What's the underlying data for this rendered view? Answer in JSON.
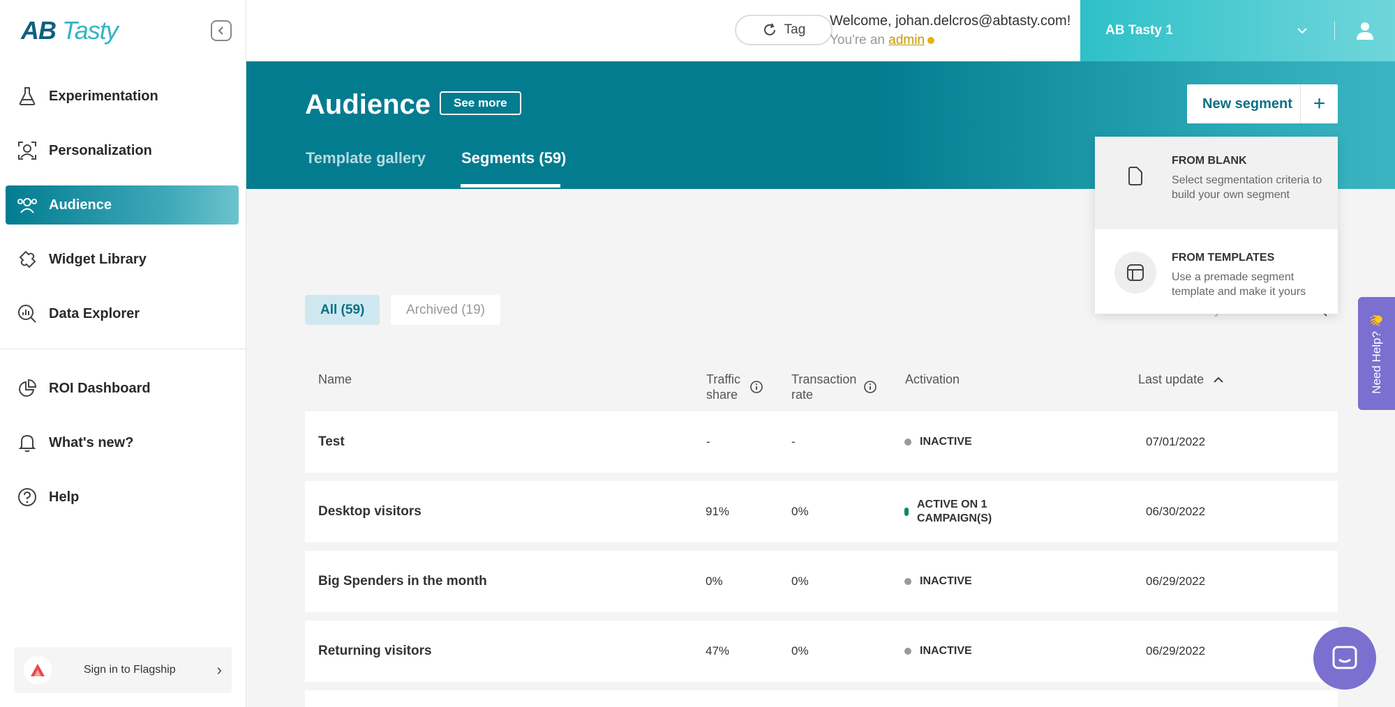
{
  "brand": {
    "logo_ab": "AB",
    "logo_tasty": "Tasty"
  },
  "sidebar": {
    "items": [
      {
        "label": "Experimentation",
        "icon": "flask-icon"
      },
      {
        "label": "Personalization",
        "icon": "person-target-icon"
      },
      {
        "label": "Audience",
        "icon": "users-icon",
        "active": true
      },
      {
        "label": "Widget Library",
        "icon": "puzzle-icon"
      },
      {
        "label": "Data Explorer",
        "icon": "chart-search-icon"
      }
    ],
    "items2": [
      {
        "label": "ROI Dashboard",
        "icon": "pie-chart-icon"
      },
      {
        "label": "What's new?",
        "icon": "bell-icon"
      },
      {
        "label": "Help",
        "icon": "help-icon"
      }
    ],
    "flagship": "Sign in to Flagship"
  },
  "topbar": {
    "tag_label": "Tag",
    "welcome": "Welcome, johan.delcros@abtasty.com!",
    "role_prefix": "You're an",
    "role": "admin",
    "account": "AB Tasty 1"
  },
  "header": {
    "title": "Audience",
    "see_more": "See more",
    "tabs": [
      "Template gallery",
      "Segments (59)"
    ],
    "new_segment": "New segment"
  },
  "dropdown": {
    "blank_title": "FROM BLANK",
    "blank_desc": "Select segmentation criteria to build your own segment",
    "templates_title": "FROM TEMPLATES",
    "templates_desc": "Use a premade segment template and make it yours"
  },
  "filters": {
    "all": "All (59)",
    "archived": "Archived (19)",
    "search_placeholder": "Search by name"
  },
  "need_help": "Need Help? 👋",
  "table": {
    "headers": {
      "name": "Name",
      "traffic_1": "Traffic",
      "traffic_2": "share",
      "trans_1": "Transaction",
      "trans_2": "rate",
      "activation": "Activation",
      "last_update": "Last update"
    },
    "rows": [
      {
        "name": "Test",
        "traffic": "-",
        "trans": "-",
        "activation": "INACTIVE",
        "status": "inactive",
        "date": "07/01/2022"
      },
      {
        "name": "Desktop visitors",
        "traffic": "91%",
        "trans": "0%",
        "activation_1": "ACTIVE ON 1",
        "activation_2": "CAMPAIGN(S)",
        "status": "active",
        "date": "06/30/2022"
      },
      {
        "name": "Big Spenders in the month",
        "traffic": "0%",
        "trans": "0%",
        "activation": "INACTIVE",
        "status": "inactive",
        "date": "06/29/2022"
      },
      {
        "name": "Returning visitors",
        "traffic": "47%",
        "trans": "0%",
        "activation": "INACTIVE",
        "status": "inactive",
        "date": "06/29/2022"
      }
    ]
  },
  "colors": {
    "primary": "#037c90",
    "accent": "#2ec0c8",
    "active_status": "#0a8a5a",
    "inactive_status": "#9a9a9a",
    "help": "#7b6fd0"
  }
}
